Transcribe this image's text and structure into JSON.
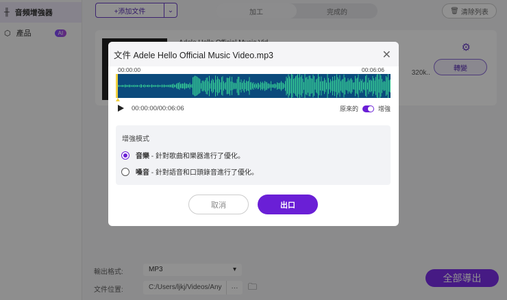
{
  "sidebar": {
    "items": [
      {
        "label": "音頻增強器",
        "icon": "waveform-icon"
      },
      {
        "label": "產品",
        "icon": "cube-icon",
        "badge": "AI"
      }
    ]
  },
  "toolbar": {
    "add_file": "+添加文件",
    "tabs": [
      "加工",
      "完成的"
    ],
    "clear_list": "清除列表"
  },
  "file_card": {
    "name": "Adele  Hello Official Music Vid",
    "rate": "320k..",
    "convert": "轉變"
  },
  "bottom": {
    "format_label": "輸出格式:",
    "format_value": "MP3",
    "location_label": "文件位置:",
    "location_value": "C:/Users/ljkj/Videos/Any",
    "more": "···",
    "export_all": "全部導出"
  },
  "dialog": {
    "title": "文件 Adele  Hello Official Music Video.mp3",
    "time_start": "00:00:00",
    "time_end": "00:06:06",
    "timecode": "00:00:00/00:06:06",
    "toggle_left": "原來的",
    "toggle_right": "增強",
    "toggle_on": true,
    "mode_title": "增強模式",
    "options": [
      {
        "name": "音樂",
        "desc": " - 針對歌曲和樂器進行了優化。",
        "selected": true
      },
      {
        "name": "嗓音",
        "desc": " - 針對語音和口頭錄音進行了優化。",
        "selected": false
      }
    ],
    "cancel": "取消",
    "export": "出口"
  },
  "colors": {
    "accent": "#6a1fd6",
    "wave_bg": "#0b4a7c",
    "wave_fg": "#3ee89a"
  }
}
